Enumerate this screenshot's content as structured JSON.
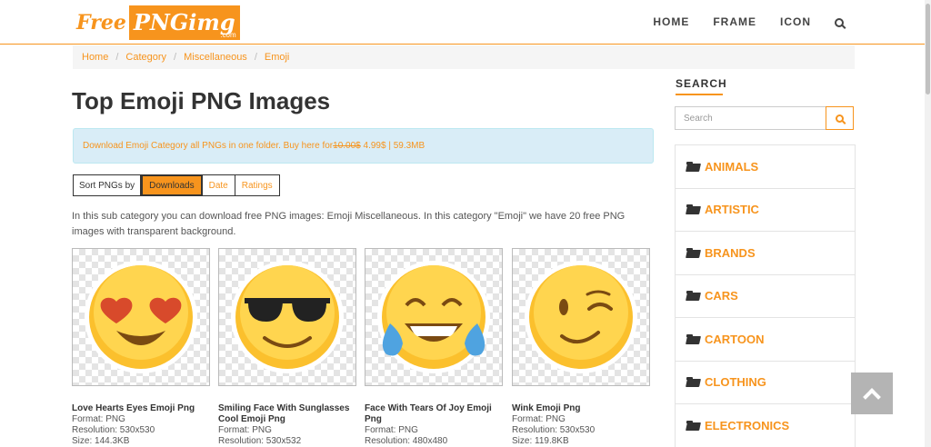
{
  "header": {
    "logo_free": "Free",
    "logo_png": "PNGimg",
    "logo_com": ".com",
    "nav": [
      "HOME",
      "FRAME",
      "ICON"
    ]
  },
  "breadcrumb": [
    "Home",
    "Category",
    "Miscellaneous",
    "Emoji"
  ],
  "main": {
    "title": "Top Emoji PNG Images",
    "alert": {
      "text_before": "Download Emoji Category all PNGs in one folder. Buy here for ",
      "old_price": "10.00$",
      "text_after": " 4.99$ | 59.3MB"
    },
    "sort": {
      "label": "Sort PNGs by",
      "options": [
        "Downloads",
        "Date",
        "Ratings"
      ],
      "active": "Downloads"
    },
    "description": "In this sub category you can download free PNG images: Emoji Miscellaneous. In this category \"Emoji\" we have 20 free PNG images with transparent background.",
    "cards": [
      {
        "title": "Love Hearts Eyes Emoji Png",
        "format": "Format: PNG",
        "resolution": "Resolution: 530x530",
        "size": "Size: 144.3KB",
        "icon": "heart-eyes-emoji-icon"
      },
      {
        "title": "Smiling Face With Sunglasses Cool Emoji Png",
        "format": "Format: PNG",
        "resolution": "Resolution: 530x532",
        "size": "",
        "icon": "sunglasses-emoji-icon"
      },
      {
        "title": "Face With Tears Of Joy Emoji Png",
        "format": "Format: PNG",
        "resolution": "Resolution: 480x480",
        "size": "",
        "icon": "tears-of-joy-emoji-icon"
      },
      {
        "title": "Wink Emoji Png",
        "format": "Format: PNG",
        "resolution": "Resolution: 530x530",
        "size": "Size: 119.8KB",
        "icon": "wink-emoji-icon"
      }
    ]
  },
  "sidebar": {
    "title": "SEARCH",
    "search_placeholder": "Search",
    "categories": [
      "ANIMALS",
      "ARTISTIC",
      "BRANDS",
      "CARS",
      "CARTOON",
      "CLOTHING",
      "ELECTRONICS"
    ]
  },
  "colors": {
    "accent": "#f7941d",
    "alert_bg": "#d9edf7",
    "back_to_top": "#b4b4b4"
  }
}
